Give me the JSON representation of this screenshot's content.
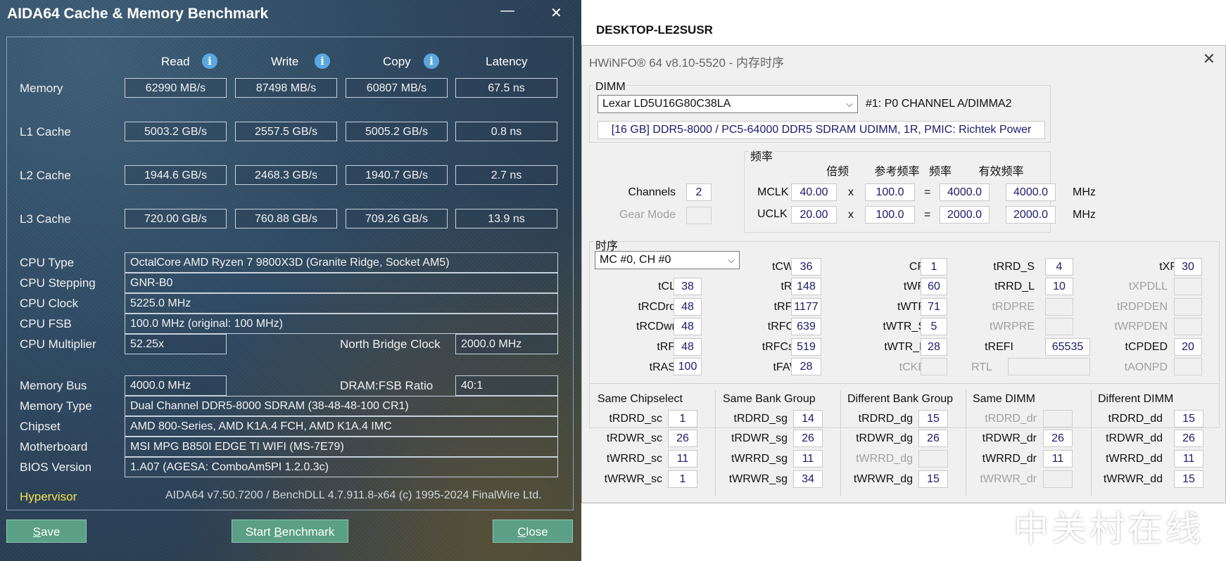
{
  "aida": {
    "title": "AIDA64 Cache & Memory Benchmark",
    "minimize": "—",
    "close_x": "✕",
    "columns": [
      "Read",
      "Write",
      "Copy",
      "Latency"
    ],
    "bench_rows": [
      {
        "label": "Memory",
        "read": "62990 MB/s",
        "write": "87498 MB/s",
        "copy": "60807 MB/s",
        "latency": "67.5 ns"
      },
      {
        "label": "L1 Cache",
        "read": "5003.2 GB/s",
        "write": "2557.5 GB/s",
        "copy": "5005.2 GB/s",
        "latency": "0.8 ns"
      },
      {
        "label": "L2 Cache",
        "read": "1944.6 GB/s",
        "write": "2468.3 GB/s",
        "copy": "1940.7 GB/s",
        "latency": "2.7 ns"
      },
      {
        "label": "L3 Cache",
        "read": "720.00 GB/s",
        "write": "760.88 GB/s",
        "copy": "709.26 GB/s",
        "latency": "13.9 ns"
      }
    ],
    "cpu": {
      "type_label": "CPU Type",
      "type": "OctalCore AMD Ryzen 7 9800X3D  (Granite Ridge, Socket AM5)",
      "stepping_label": "CPU Stepping",
      "stepping": "GNR-B0",
      "clock_label": "CPU Clock",
      "clock": "5225.0 MHz",
      "fsb_label": "CPU FSB",
      "fsb": "100.0 MHz  (original: 100 MHz)",
      "mult_label": "CPU Multiplier",
      "mult": "52.25x",
      "nb_label": "North Bridge Clock",
      "nb": "2000.0 MHz"
    },
    "mem": {
      "bus_label": "Memory Bus",
      "bus": "4000.0 MHz",
      "ratio_label": "DRAM:FSB Ratio",
      "ratio": "40:1",
      "type_label": "Memory Type",
      "type": "Dual Channel DDR5-8000 SDRAM  (38-48-48-100 CR1)",
      "chipset_label": "Chipset",
      "chipset": "AMD 800-Series, AMD K1A.4 FCH, AMD K1A.4 IMC",
      "mb_label": "Motherboard",
      "mb": "MSI MPG B850I EDGE TI WIFI (MS-7E79)",
      "bios_label": "BIOS Version",
      "bios": "1.A07  (AGESA: ComboAm5PI 1.2.0.3c)"
    },
    "hypervisor": "Hypervisor",
    "version": "AIDA64 v7.50.7200 / BenchDLL 4.7.911.8-x64  (c) 1995-2024 FinalWire Ltd.",
    "buttons": {
      "save_u": "S",
      "save_rest": "ave",
      "start_pre": "Start ",
      "start_u": "B",
      "start_rest": "enchmark",
      "close_u": "C",
      "close_rest": "lose"
    },
    "colors": {
      "hypervisor": "#f3e34a",
      "button": "#5a9f86"
    }
  },
  "hostname": "DESKTOP-LE2SUSR",
  "hw": {
    "title": "HWiNFO® 64 v8.10-5520 - 内存时序",
    "close_x": "✕",
    "dimm_label": "DIMM",
    "dimm_select": "Lexar LD5U16G80C38LA",
    "slot": "#1: P0 CHANNEL A/DIMMA2",
    "dimm_desc": "[16 GB] DDR5-8000 / PC5-64000 DDR5 SDRAM UDIMM, 1R, PMIC: Richtek Power",
    "freq_label": "频率",
    "freq_headers": [
      "倍频",
      "参考频率",
      "频率",
      "有效频率"
    ],
    "channels_label": "Channels",
    "channels": "2",
    "gear_label": "Gear Mode",
    "gear": "",
    "mclk": {
      "label": "MCLK",
      "mult": "40.00",
      "ref": "100.0",
      "freq": "4000.0",
      "eff": "4000.0"
    },
    "uclk": {
      "label": "UCLK",
      "mult": "20.00",
      "ref": "100.0",
      "freq": "2000.0",
      "eff": "2000.0"
    },
    "x_sign": "x",
    "eq_sign": "=",
    "mhz": "MHz",
    "timing_label": "时序",
    "mc_select": "MC #0, CH #0",
    "timings": {
      "tCL": "38",
      "tRCDrd": "48",
      "tRCDwr": "48",
      "tRP": "48",
      "tRAS": "100",
      "tCWL": "36",
      "tRC": "148",
      "tRFC": "1177",
      "tRFC2": "639",
      "tRFCsb": "519",
      "tFAW": "28",
      "CR": "1",
      "tWR": "60",
      "tWTP": "71",
      "tWTR_S": "5",
      "tWTR_L": "28",
      "tCKE": "",
      "tRRD_S": "4",
      "tRRD_L": "10",
      "tRDPRE": "",
      "tWRPRE": "",
      "tREFI": "65535",
      "RTL": "",
      "tXP": "30",
      "tXPDLL": "",
      "tRDPDEN": "",
      "tWRPDEN": "",
      "tCPDED": "20",
      "tAONPD": ""
    },
    "groups": [
      {
        "title": "Same Chipselect",
        "rows": [
          {
            "label": "tRDRD_sc",
            "value": "1"
          },
          {
            "label": "tRDWR_sc",
            "value": "26"
          },
          {
            "label": "tWRRD_sc",
            "value": "11"
          },
          {
            "label": "tWRWR_sc",
            "value": "1"
          }
        ]
      },
      {
        "title": "Same Bank Group",
        "rows": [
          {
            "label": "tRDRD_sg",
            "value": "14"
          },
          {
            "label": "tRDWR_sg",
            "value": "26"
          },
          {
            "label": "tWRRD_sg",
            "value": "11"
          },
          {
            "label": "tWRWR_sg",
            "value": "34"
          }
        ]
      },
      {
        "title": "Different Bank Group",
        "rows": [
          {
            "label": "tRDRD_dg",
            "value": "15"
          },
          {
            "label": "tRDWR_dg",
            "value": "26"
          },
          {
            "label": "tWRRD_dg",
            "value": ""
          },
          {
            "label": "tWRWR_dg",
            "value": "15"
          }
        ]
      },
      {
        "title": "Same DIMM",
        "rows": [
          {
            "label": "tRDRD_dr",
            "value": ""
          },
          {
            "label": "tRDWR_dr",
            "value": "26"
          },
          {
            "label": "tWRRD_dr",
            "value": "11"
          },
          {
            "label": "tWRWR_dr",
            "value": ""
          }
        ]
      },
      {
        "title": "Different DIMM",
        "rows": [
          {
            "label": "tRDRD_dd",
            "value": "15"
          },
          {
            "label": "tRDWR_dd",
            "value": "26"
          },
          {
            "label": "tWRRD_dd",
            "value": "11"
          },
          {
            "label": "tWRWR_dd",
            "value": "15"
          }
        ]
      }
    ]
  },
  "watermark": "中关村在线"
}
